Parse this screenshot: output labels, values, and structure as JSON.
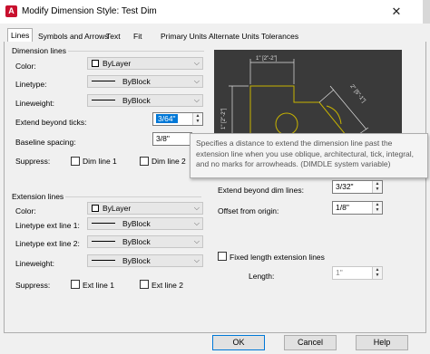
{
  "window": {
    "title": "Modify Dimension Style: Test Dim",
    "app_icon": "A"
  },
  "tabs": [
    {
      "label": "Lines"
    },
    {
      "label": "Symbols and Arrows"
    },
    {
      "label": "Text"
    },
    {
      "label": "Fit"
    },
    {
      "label": "Primary Units"
    },
    {
      "label": "Alternate Units"
    },
    {
      "label": "Tolerances"
    }
  ],
  "dimension_lines": {
    "title": "Dimension lines",
    "color_label": "Color:",
    "color_value": "ByLayer",
    "linetype_label": "Linetype:",
    "linetype_value": "ByBlock",
    "lineweight_label": "Lineweight:",
    "lineweight_value": "ByBlock",
    "extend_ticks_label": "Extend beyond ticks:",
    "extend_ticks_value": "3/64\"",
    "baseline_label": "Baseline spacing:",
    "baseline_value": "3/8\"",
    "suppress_label": "Suppress:",
    "dim_line1": "Dim line 1",
    "dim_line2": "Dim line 2"
  },
  "extension_lines": {
    "title": "Extension lines",
    "color_label": "Color:",
    "color_value": "ByLayer",
    "linetype1_label": "Linetype ext line 1:",
    "linetype1_value": "ByBlock",
    "linetype2_label": "Linetype ext line 2:",
    "linetype2_value": "ByBlock",
    "lineweight_label": "Lineweight:",
    "lineweight_value": "ByBlock",
    "suppress_label": "Suppress:",
    "ext_line1": "Ext line 1",
    "ext_line2": "Ext line 2",
    "extend_beyond_label": "Extend beyond dim lines:",
    "extend_beyond_value": "3/32\"",
    "offset_label": "Offset from origin:",
    "offset_value": "1/8\"",
    "fixed_length_label": "Fixed length extension lines",
    "length_label": "Length:",
    "length_value": "1\""
  },
  "preview": {
    "dim_top": "1\" [2\"-2\"]",
    "dim_left": "1\" [2\"-2\"]",
    "dim_slanted": "2\" [5\"-1\"]"
  },
  "tooltip": {
    "text": "Specifies a distance to extend the dimension line past the extension line when you use oblique, architectural, tick, integral, and no marks for arrowheads. (DIMDLE system variable)"
  },
  "buttons": {
    "ok": "OK",
    "cancel": "Cancel",
    "help": "Help"
  },
  "colors": {
    "accent": "#0078d7",
    "preview_bg": "#3a3a3a",
    "preview_line": "#c8b400"
  }
}
